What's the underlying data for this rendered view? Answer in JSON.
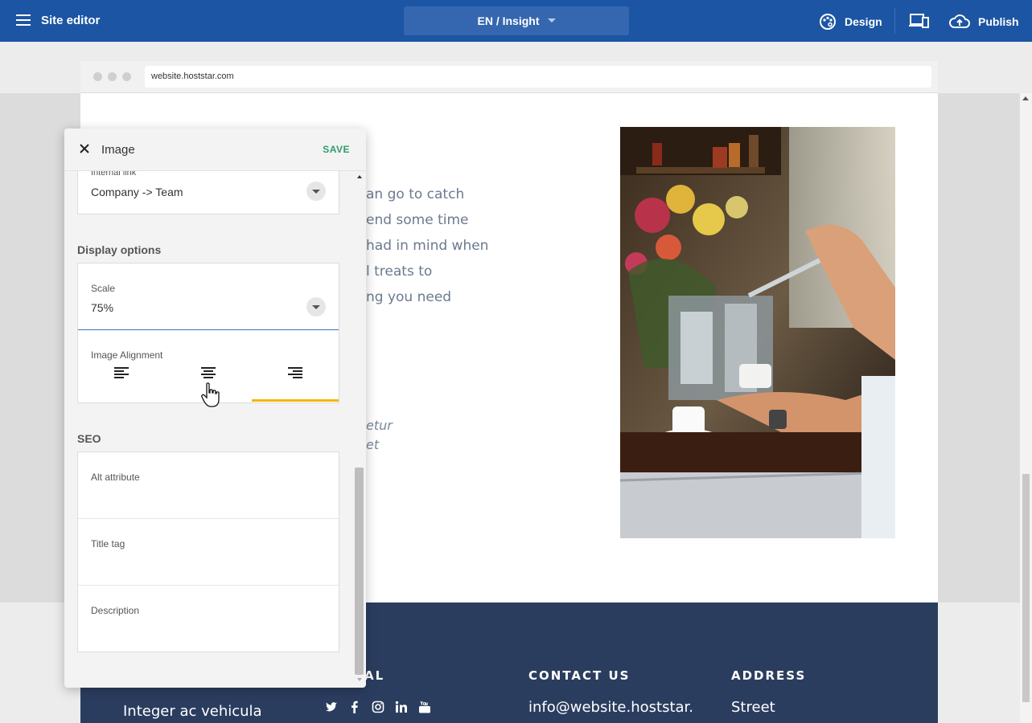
{
  "topbar": {
    "title": "Site editor",
    "language": "EN / Insight",
    "design_label": "Design",
    "publish_label": "Publish",
    "color": "#1c55a3"
  },
  "browser": {
    "url": "website.hoststar.com"
  },
  "page": {
    "body_lines": [
      "an go to catch",
      "end some time",
      "had in mind when",
      "l treats to",
      "ng you need"
    ],
    "italic_lines": [
      "etur",
      "et"
    ],
    "footer": {
      "col1_text": "Integer ac vehicula",
      "col2_title": "AL",
      "col3_title": "CONTACT US",
      "col3_text": "info@website.hoststar.",
      "col4_title": "ADDRESS",
      "col4_text": "Street",
      "social_icons": [
        "twitter-icon",
        "facebook-icon",
        "instagram-icon",
        "linkedin-icon",
        "youtube-icon"
      ]
    }
  },
  "panel": {
    "title": "Image",
    "save_label": "SAVE",
    "internal_link": {
      "label": "Internal link",
      "value": "Company -> Team"
    },
    "display_options": {
      "title": "Display options",
      "scale_label": "Scale",
      "scale_value": "75%",
      "alignment_label": "Image Alignment",
      "alignment_options": [
        "left",
        "center",
        "right"
      ],
      "alignment_selected": "right"
    },
    "seo": {
      "title": "SEO",
      "fields": [
        {
          "label": "Alt attribute",
          "value": ""
        },
        {
          "label": "Title tag",
          "value": ""
        },
        {
          "label": "Description",
          "value": ""
        }
      ]
    },
    "accent_color": "#2e9c6c",
    "selected_color": "#f0b800"
  }
}
